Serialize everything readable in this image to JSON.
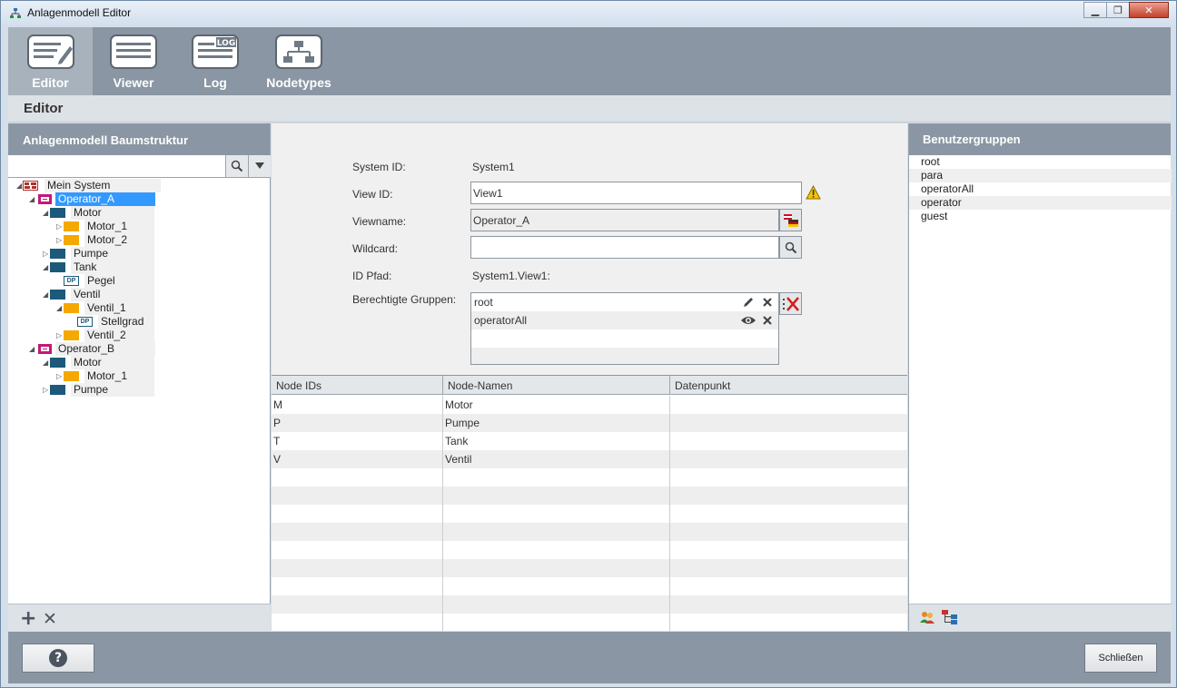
{
  "window": {
    "title": "Anlagenmodell Editor"
  },
  "toolbar": {
    "items": [
      {
        "label": "Editor",
        "active": true
      },
      {
        "label": "Viewer",
        "active": false
      },
      {
        "label": "Log",
        "active": false
      },
      {
        "label": "Nodetypes",
        "active": false
      }
    ]
  },
  "section": {
    "title": "Editor"
  },
  "left_panel": {
    "title": "Anlagenmodell Baumstruktur",
    "search_value": "",
    "tree": [
      {
        "label": "Mein System",
        "icon": "system-icon",
        "expanded": true
      },
      {
        "label": "Operator_A",
        "icon": "operator-icon",
        "expanded": true,
        "selected": true
      },
      {
        "label": "Motor",
        "icon": "node-blue-icon",
        "expanded": true
      },
      {
        "label": "Motor_1",
        "icon": "node-orange-icon",
        "expanded": false
      },
      {
        "label": "Motor_2",
        "icon": "node-orange-icon",
        "expanded": false
      },
      {
        "label": "Pumpe",
        "icon": "node-blue-icon",
        "expanded": false
      },
      {
        "label": "Tank",
        "icon": "node-blue-icon",
        "expanded": true
      },
      {
        "label": "Pegel",
        "icon": "datapoint-icon"
      },
      {
        "label": "Ventil",
        "icon": "node-blue-icon",
        "expanded": true
      },
      {
        "label": "Ventil_1",
        "icon": "node-orange-icon",
        "expanded": true
      },
      {
        "label": "Stellgrad",
        "icon": "datapoint-icon"
      },
      {
        "label": "Ventil_2",
        "icon": "node-orange-icon",
        "expanded": false
      },
      {
        "label": "Operator_B",
        "icon": "operator-icon",
        "expanded": true
      },
      {
        "label": "Motor",
        "icon": "node-blue-icon",
        "expanded": true
      },
      {
        "label": "Motor_1",
        "icon": "node-orange-icon",
        "expanded": false
      },
      {
        "label": "Pumpe",
        "icon": "node-blue-icon",
        "expanded": false
      }
    ],
    "datapoint_badge": "DP"
  },
  "form": {
    "system_id_label": "System ID:",
    "system_id_value": "System1",
    "view_id_label": "View ID:",
    "view_id_value": "View1",
    "viewname_label": "Viewname:",
    "viewname_value": "Operator_A",
    "wildcard_label": "Wildcard:",
    "wildcard_value": "",
    "id_pfad_label": "ID Pfad:",
    "id_pfad_value": "System1.View1:",
    "groups_label": "Berechtigte Gruppen:",
    "groups": [
      {
        "name": "root",
        "action_icon": "pencil-icon"
      },
      {
        "name": "operatorAll",
        "action_icon": "eye-icon"
      }
    ]
  },
  "table": {
    "headers": [
      "Node IDs",
      "Node-Namen",
      "Datenpunkt"
    ],
    "rows": [
      [
        "M",
        "Motor",
        ""
      ],
      [
        "P",
        "Pumpe",
        ""
      ],
      [
        "T",
        "Tank",
        ""
      ],
      [
        "V",
        "Ventil",
        ""
      ],
      [
        "",
        "",
        ""
      ],
      [
        "",
        "",
        ""
      ],
      [
        "",
        "",
        ""
      ],
      [
        "",
        "",
        ""
      ],
      [
        "",
        "",
        ""
      ],
      [
        "",
        "",
        ""
      ],
      [
        "",
        "",
        ""
      ],
      [
        "",
        "",
        ""
      ],
      [
        "",
        "",
        ""
      ]
    ]
  },
  "right_panel": {
    "title": "Benutzergruppen",
    "groups": [
      "root",
      "para",
      "operatorAll",
      "operator",
      "guest"
    ]
  },
  "bottom": {
    "help_label": "?",
    "close_label": "Schließen"
  },
  "colors": {
    "panel_header": "#8a96a3",
    "selection": "#3399ff",
    "node_blue": "#1b5a7a",
    "node_orange": "#f5a800",
    "operator": "#c2187a"
  }
}
